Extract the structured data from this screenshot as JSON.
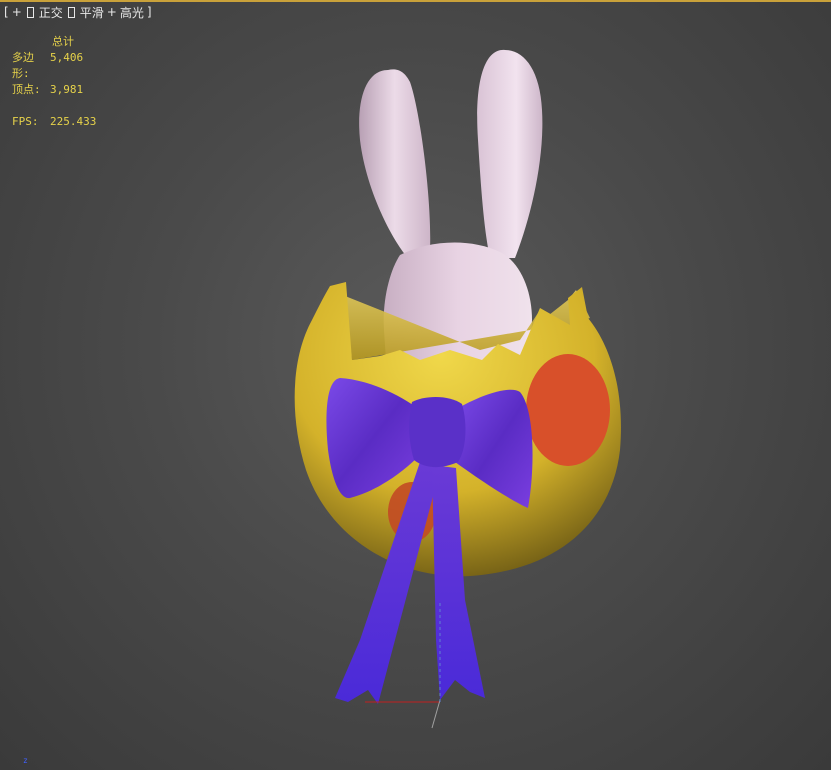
{
  "viewport_menu": {
    "open_bracket": "[",
    "plus": "+",
    "view": "正交",
    "shading": "平滑",
    "plus2": "+",
    "highlight": "高光",
    "close_bracket": "]"
  },
  "stats": {
    "header": "总计",
    "polygons_label": "多边形:",
    "polygons_value": "5,406",
    "vertices_label": "顶点:",
    "vertices_value": "3,981",
    "fps_label": "FPS:",
    "fps_value": "225.433"
  },
  "axis_label": "z",
  "colors": {
    "egg_yellow": "#e8c832",
    "spots": "#d8502a",
    "bow_purple": "#6a36d8",
    "bunny": "#e8d4e2",
    "stats_text": "#e6d24a",
    "viewport_border": "#c9a13a"
  }
}
